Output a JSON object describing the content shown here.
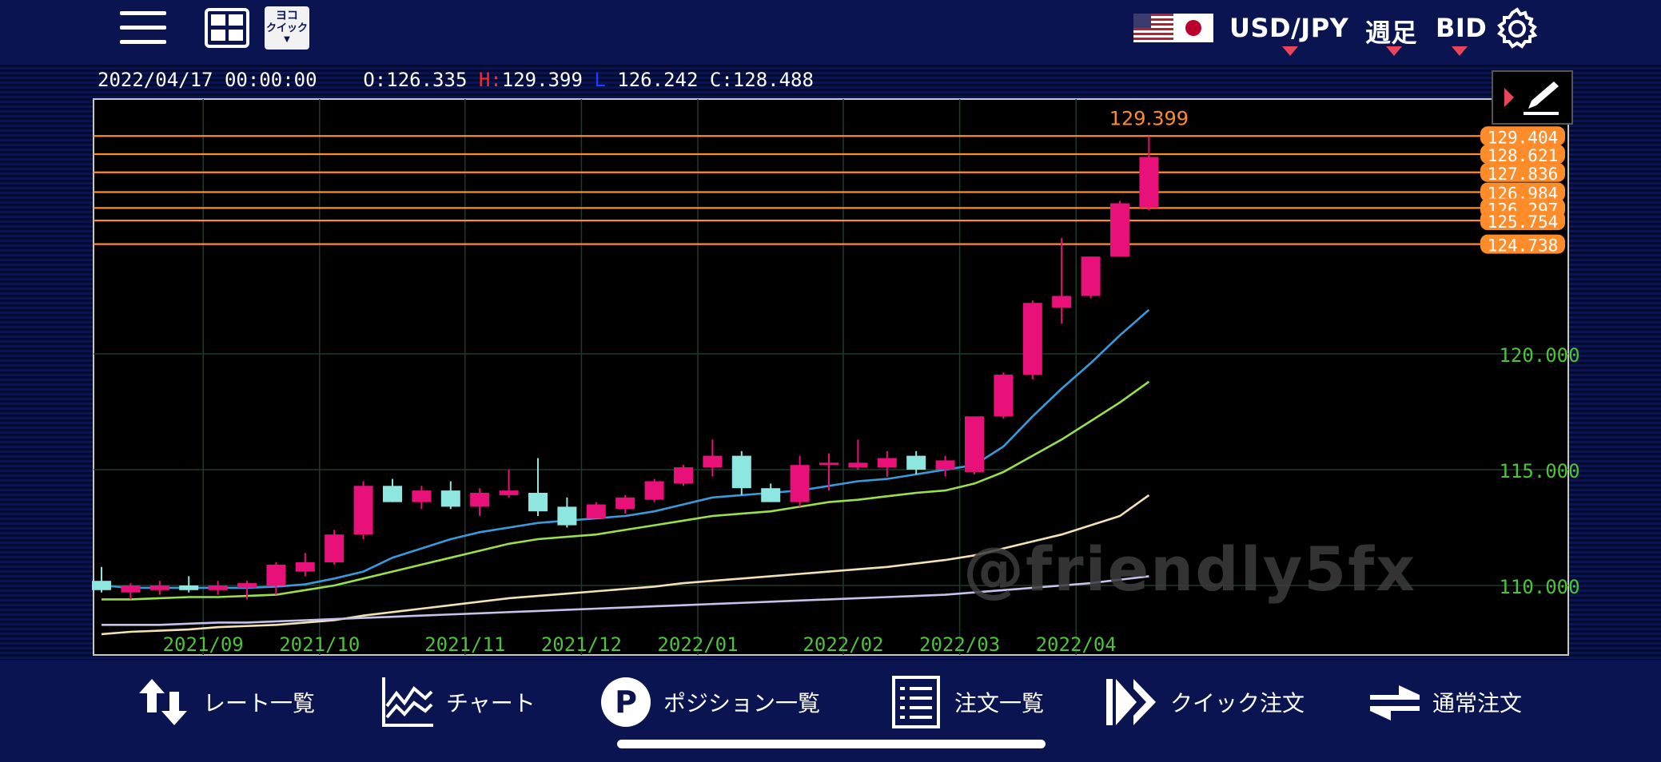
{
  "header": {
    "currency_pair": "USD/JPY",
    "timeframe": "週足",
    "price_type": "BID",
    "quick_badge_line1": "ヨコ",
    "quick_badge_line2": "クイック",
    "quick_badge_line3": "▼"
  },
  "ohlc_bar": {
    "datetime": "2022/04/17 00:00:00",
    "open_label": "O:",
    "open": "126.335",
    "high_label": "H:",
    "high": "129.399",
    "low_label": "L",
    "low": "126.242",
    "close_label": "C:",
    "close": "128.488"
  },
  "watermark": "@friendly5fx",
  "tabs": [
    {
      "label": "レート一覧",
      "icon": "arrows-up-down-icon"
    },
    {
      "label": "チャート",
      "icon": "line-chart-icon"
    },
    {
      "label": "ポジション一覧",
      "icon": "position-p-icon"
    },
    {
      "label": "注文一覧",
      "icon": "order-list-icon"
    },
    {
      "label": "クイック注文",
      "icon": "fast-forward-icon"
    },
    {
      "label": "通常注文",
      "icon": "swap-arrows-icon"
    }
  ],
  "colors": {
    "background": "#0a1450",
    "chart_bg": "#000000",
    "bull": "#e8117a",
    "bear": "#8ee6e0",
    "axis_label": "#4fc23a",
    "hline": "#ff8c2a",
    "ma_blue": "#3a9ad9",
    "ma_green": "#9be049",
    "ma_cream": "#f4e2b5",
    "ma_lavender": "#c6c2ec"
  },
  "chart_data": {
    "type": "candlestick",
    "timeframe": "weekly",
    "x_labels": [
      "2021/09",
      "2021/10",
      "2021/11",
      "2021/12",
      "2022/01",
      "2022/02",
      "2022/03",
      "2022/04"
    ],
    "x_label_index": [
      3,
      7,
      12,
      16,
      20,
      25,
      29,
      33
    ],
    "ylim": [
      107.0,
      131.0
    ],
    "y_ticks": [
      {
        "value": 110.0,
        "label": "110.000"
      },
      {
        "value": 115.0,
        "label": "115.000"
      },
      {
        "value": 120.0,
        "label": "120.000"
      }
    ],
    "high_marker": {
      "value": 129.399,
      "label": "129.399"
    },
    "horizontal_lines": [
      {
        "value": 129.404,
        "label": "129.404"
      },
      {
        "value": 128.621,
        "label": "128.621"
      },
      {
        "value": 127.836,
        "label": "127.836"
      },
      {
        "value": 126.984,
        "label": "126.984"
      },
      {
        "value": 126.297,
        "label": "126.297"
      },
      {
        "value": 125.754,
        "label": "125.754"
      },
      {
        "value": 124.738,
        "label": "124.738"
      }
    ],
    "candles": [
      {
        "o": 110.2,
        "h": 110.8,
        "l": 109.7,
        "c": 109.8
      },
      {
        "o": 109.7,
        "h": 110.1,
        "l": 109.4,
        "c": 110.0
      },
      {
        "o": 109.8,
        "h": 110.2,
        "l": 109.6,
        "c": 110.0
      },
      {
        "o": 110.0,
        "h": 110.4,
        "l": 109.7,
        "c": 109.8
      },
      {
        "o": 109.8,
        "h": 110.2,
        "l": 109.6,
        "c": 110.0
      },
      {
        "o": 109.9,
        "h": 110.2,
        "l": 109.4,
        "c": 110.1
      },
      {
        "o": 110.0,
        "h": 111.0,
        "l": 109.6,
        "c": 110.9
      },
      {
        "o": 110.6,
        "h": 111.4,
        "l": 110.4,
        "c": 111.0
      },
      {
        "o": 111.0,
        "h": 112.4,
        "l": 110.9,
        "c": 112.2
      },
      {
        "o": 112.2,
        "h": 114.5,
        "l": 112.0,
        "c": 114.3
      },
      {
        "o": 114.3,
        "h": 114.6,
        "l": 113.6,
        "c": 113.6
      },
      {
        "o": 113.6,
        "h": 114.3,
        "l": 113.3,
        "c": 114.1
      },
      {
        "o": 114.1,
        "h": 114.5,
        "l": 113.3,
        "c": 113.4
      },
      {
        "o": 113.4,
        "h": 114.2,
        "l": 113.0,
        "c": 114.0
      },
      {
        "o": 113.9,
        "h": 115.0,
        "l": 113.8,
        "c": 114.1
      },
      {
        "o": 114.0,
        "h": 115.5,
        "l": 113.0,
        "c": 113.2
      },
      {
        "o": 113.4,
        "h": 113.8,
        "l": 112.5,
        "c": 112.6
      },
      {
        "o": 112.9,
        "h": 113.6,
        "l": 112.9,
        "c": 113.5
      },
      {
        "o": 113.3,
        "h": 113.9,
        "l": 113.1,
        "c": 113.8
      },
      {
        "o": 113.7,
        "h": 114.6,
        "l": 113.6,
        "c": 114.5
      },
      {
        "o": 114.4,
        "h": 115.2,
        "l": 114.3,
        "c": 115.1
      },
      {
        "o": 115.1,
        "h": 116.3,
        "l": 114.7,
        "c": 115.6
      },
      {
        "o": 115.6,
        "h": 115.8,
        "l": 113.9,
        "c": 114.2
      },
      {
        "o": 114.2,
        "h": 114.4,
        "l": 113.6,
        "c": 113.6
      },
      {
        "o": 113.6,
        "h": 115.6,
        "l": 113.4,
        "c": 115.2
      },
      {
        "o": 115.2,
        "h": 115.7,
        "l": 114.1,
        "c": 115.3
      },
      {
        "o": 115.1,
        "h": 116.3,
        "l": 115.0,
        "c": 115.3
      },
      {
        "o": 115.1,
        "h": 115.8,
        "l": 114.7,
        "c": 115.5
      },
      {
        "o": 115.6,
        "h": 115.8,
        "l": 114.8,
        "c": 115.0
      },
      {
        "o": 115.0,
        "h": 115.6,
        "l": 114.7,
        "c": 115.4
      },
      {
        "o": 114.9,
        "h": 117.3,
        "l": 114.8,
        "c": 117.3
      },
      {
        "o": 117.3,
        "h": 119.2,
        "l": 117.2,
        "c": 119.1
      },
      {
        "o": 119.1,
        "h": 122.3,
        "l": 118.9,
        "c": 122.2
      },
      {
        "o": 122.0,
        "h": 125.0,
        "l": 121.3,
        "c": 122.5
      },
      {
        "o": 122.5,
        "h": 124.2,
        "l": 122.4,
        "c": 124.2
      },
      {
        "o": 124.2,
        "h": 126.6,
        "l": 124.2,
        "c": 126.5
      },
      {
        "o": 126.3,
        "h": 129.4,
        "l": 126.2,
        "c": 128.5
      }
    ],
    "moving_averages": [
      {
        "color": "#3a9ad9",
        "values": [
          110.0,
          109.9,
          109.9,
          109.9,
          109.9,
          109.9,
          109.95,
          110.05,
          110.3,
          110.6,
          111.2,
          111.6,
          112.0,
          112.3,
          112.5,
          112.7,
          112.8,
          112.9,
          113.0,
          113.2,
          113.5,
          113.8,
          113.9,
          114.0,
          114.1,
          114.3,
          114.5,
          114.6,
          114.8,
          115.0,
          115.2,
          116.0,
          117.3,
          118.5,
          119.6,
          120.8,
          121.9
        ]
      },
      {
        "color": "#9be049",
        "values": [
          109.4,
          109.4,
          109.45,
          109.5,
          109.5,
          109.55,
          109.6,
          109.8,
          110.0,
          110.3,
          110.6,
          110.9,
          111.2,
          111.5,
          111.8,
          112.0,
          112.1,
          112.2,
          112.4,
          112.6,
          112.8,
          113.0,
          113.1,
          113.2,
          113.4,
          113.6,
          113.7,
          113.85,
          114.0,
          114.1,
          114.4,
          114.9,
          115.6,
          116.3,
          117.1,
          117.9,
          118.8
        ]
      },
      {
        "color": "#f4e2b5",
        "values": [
          107.9,
          108.0,
          108.05,
          108.1,
          108.2,
          108.25,
          108.3,
          108.4,
          108.5,
          108.7,
          108.85,
          109.0,
          109.15,
          109.3,
          109.45,
          109.55,
          109.65,
          109.75,
          109.85,
          109.95,
          110.1,
          110.2,
          110.3,
          110.4,
          110.5,
          110.6,
          110.7,
          110.8,
          110.95,
          111.1,
          111.3,
          111.6,
          111.9,
          112.2,
          112.6,
          113.0,
          113.9
        ]
      },
      {
        "color": "#c6c2ec",
        "values": [
          108.3,
          108.3,
          108.3,
          108.35,
          108.4,
          108.4,
          108.45,
          108.5,
          108.55,
          108.6,
          108.65,
          108.7,
          108.75,
          108.8,
          108.85,
          108.9,
          108.95,
          109.0,
          109.05,
          109.1,
          109.15,
          109.2,
          109.25,
          109.3,
          109.35,
          109.4,
          109.45,
          109.5,
          109.55,
          109.6,
          109.7,
          109.8,
          109.9,
          110.0,
          110.1,
          110.25,
          110.4
        ]
      }
    ]
  }
}
